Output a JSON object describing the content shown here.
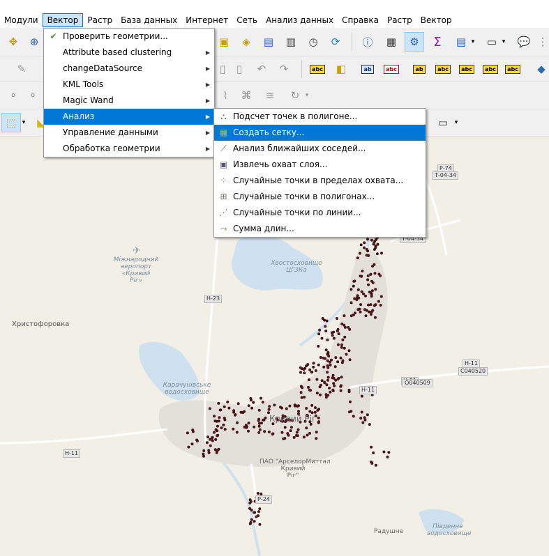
{
  "menubar": {
    "items": [
      {
        "label": "Модули"
      },
      {
        "label": "Вектор",
        "active": true
      },
      {
        "label": "Растр"
      },
      {
        "label": "База данных"
      },
      {
        "label": "Интернет"
      },
      {
        "label": "Сеть"
      },
      {
        "label": "Анализ данных"
      },
      {
        "label": "Справка"
      },
      {
        "label": "Растр"
      },
      {
        "label": "Вектор"
      }
    ]
  },
  "vector_menu": {
    "items": [
      {
        "label": "Проверить геометрии...",
        "icon": "check-icon",
        "submenu": false
      },
      {
        "label": "Attribute based clustering",
        "submenu": true
      },
      {
        "label": "changeDataSource",
        "submenu": true
      },
      {
        "label": "KML Tools",
        "submenu": true
      },
      {
        "label": "Magic Wand",
        "submenu": true
      },
      {
        "label": "Анализ",
        "submenu": true,
        "highlighted": true
      },
      {
        "label": "Управление данными",
        "submenu": true
      },
      {
        "label": "Обработка геометрии",
        "submenu": true
      }
    ]
  },
  "analysis_submenu": {
    "items": [
      {
        "label": "Подсчет точек в полигоне...",
        "icon": "count-points-icon"
      },
      {
        "label": "Создать сетку...",
        "icon": "grid-icon",
        "highlighted": true
      },
      {
        "label": "Анализ ближайших соседей...",
        "icon": "nearest-neighbour-icon"
      },
      {
        "label": "Извлечь охват слоя...",
        "icon": "layer-extent-icon"
      },
      {
        "label": "Случайные точки в пределах охвата...",
        "icon": "random-points-extent-icon"
      },
      {
        "label": "Случайные точки в полигонах...",
        "icon": "random-points-polygons-icon"
      },
      {
        "label": "Случайные точки по линии...",
        "icon": "random-points-line-icon"
      },
      {
        "label": "Сумма длин...",
        "icon": "sum-lines-icon"
      }
    ]
  },
  "map": {
    "labels": {
      "airport": "Межнародний аеропорт «Кривий Ріг»",
      "airport_l1": "Міжнародний",
      "airport_l2": "аеропорт",
      "airport_l3": "«Кривий",
      "airport_l4": "Ріг»",
      "khvostoskhovyshche_l1": "Хвостосховище",
      "khvostoskhovyshche_l2": "ЦГЗКа",
      "khrystoforivka": "Христофоровка",
      "karachunivske_l1": "Карачунівське",
      "karachunivske_l2": "водосховище",
      "kryvyi_rih": "Кривий Ріг",
      "arcelor_l1": "ПАО \"АрселорМиттал",
      "arcelor_l2": "Кривий",
      "arcelor_l3": "Рiг\"",
      "radushne": "Радушне",
      "pivdenne_l1": "Південне",
      "pivdenne_l2": "водосховище"
    },
    "shields": {
      "p74": "Р-74",
      "t0434a": "Т-04-34",
      "t0434b": "Т-04-34",
      "h23": "Н-23",
      "h11_right": "Н-11",
      "c040520": "С040520",
      "o040509": "О040509",
      "h11_mid": "Н-11",
      "h11_left": "Н-11",
      "p24": "Р-24"
    },
    "colors": {
      "background": "#f1efe6",
      "water": "#cfe1ee",
      "point": "#4a1418",
      "highlight": "#0078d7"
    }
  }
}
